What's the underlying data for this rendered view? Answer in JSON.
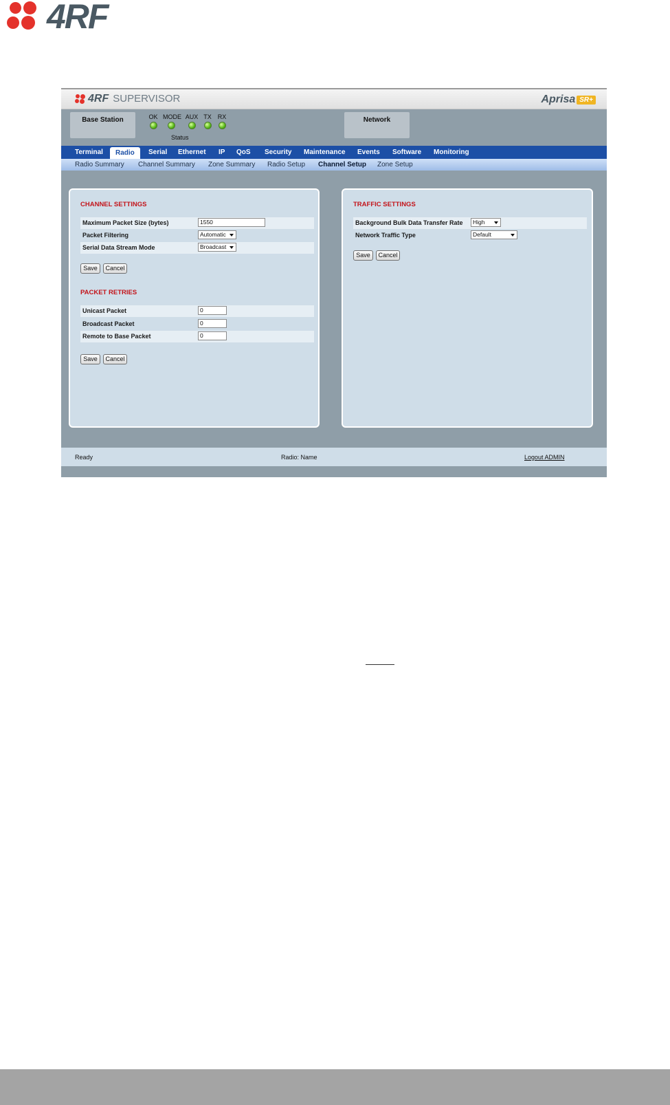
{
  "page_logo": {
    "text": "4RF"
  },
  "supervisor": {
    "brand": "4RF",
    "title": "SUPERVISOR",
    "product": "Aprisa",
    "product_badge": "SR+"
  },
  "status": {
    "base_station": "Base Station",
    "network": "Network",
    "caption": "Status",
    "leds": [
      {
        "label": "OK",
        "state": "on"
      },
      {
        "label": "MODE",
        "state": "on"
      },
      {
        "label": "AUX",
        "state": "on"
      },
      {
        "label": "TX",
        "state": "on"
      },
      {
        "label": "RX",
        "state": "on"
      }
    ]
  },
  "nav": {
    "tabs": [
      "Terminal",
      "Radio",
      "Serial",
      "Ethernet",
      "IP",
      "QoS",
      "Security",
      "Maintenance",
      "Events",
      "Software",
      "Monitoring"
    ],
    "active": "Radio"
  },
  "subnav": {
    "items": [
      "Radio Summary",
      "Channel Summary",
      "Zone Summary",
      "Radio Setup",
      "Channel Setup",
      "Zone Setup"
    ],
    "active": "Channel Setup"
  },
  "channel_settings": {
    "title": "CHANNEL SETTINGS",
    "max_packet_label": "Maximum Packet Size (bytes)",
    "max_packet_value": "1550",
    "packet_filtering_label": "Packet Filtering",
    "packet_filtering_value": "Automatic",
    "serial_mode_label": "Serial Data Stream Mode",
    "serial_mode_value": "Broadcast",
    "save": "Save",
    "cancel": "Cancel"
  },
  "packet_retries": {
    "title": "PACKET RETRIES",
    "unicast_label": "Unicast Packet",
    "unicast_value": "0",
    "broadcast_label": "Broadcast Packet",
    "broadcast_value": "0",
    "remote_label": "Remote to Base Packet",
    "remote_value": "0",
    "save": "Save",
    "cancel": "Cancel"
  },
  "traffic_settings": {
    "title": "TRAFFIC SETTINGS",
    "bulk_rate_label": "Background Bulk Data Transfer Rate",
    "bulk_rate_value": "High",
    "traffic_type_label": "Network Traffic Type",
    "traffic_type_value": "Default",
    "save": "Save",
    "cancel": "Cancel"
  },
  "footer": {
    "status": "Ready",
    "radio": "Radio: Name",
    "logout": "Logout ADMIN"
  },
  "colors": {
    "accent_blue": "#1c4fa6",
    "section_red": "#c3141a",
    "logo_red": "#e4322b",
    "led_green": "#58b818"
  }
}
